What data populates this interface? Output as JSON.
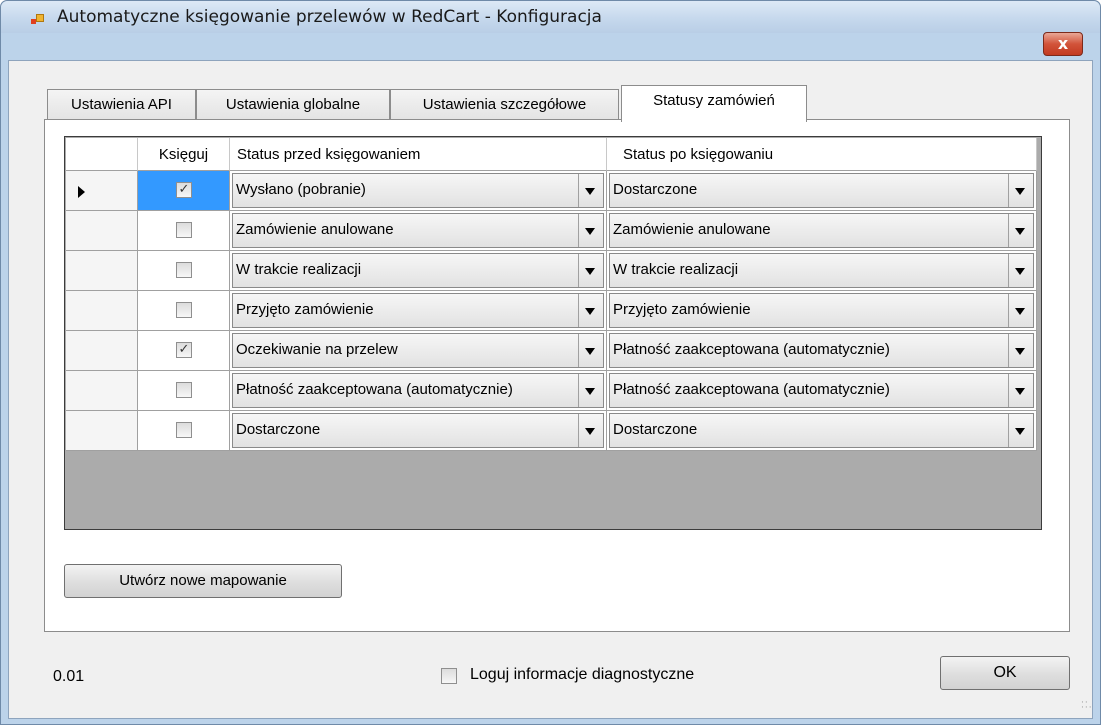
{
  "window": {
    "title": "Automatyczne księgowanie przelewów w RedCart - Konfiguracja",
    "close_label": "x"
  },
  "tabs": [
    {
      "label": "Ustawienia API",
      "active": false
    },
    {
      "label": "Ustawienia globalne",
      "active": false
    },
    {
      "label": "Ustawienia szczegółowe",
      "active": false
    },
    {
      "label": "Statusy zamówień",
      "active": true
    }
  ],
  "grid": {
    "columns": [
      "Księguj",
      "Status przed księgowaniem",
      "Status po księgowaniu"
    ],
    "rows": [
      {
        "post": true,
        "before": "Wysłano (pobranie)",
        "after": "Dostarczone",
        "selected": true
      },
      {
        "post": false,
        "before": "Zamówienie anulowane",
        "after": "Zamówienie anulowane",
        "selected": false
      },
      {
        "post": false,
        "before": "W trakcie realizacji",
        "after": "W trakcie realizacji",
        "selected": false
      },
      {
        "post": false,
        "before": "Przyjęto zamówienie",
        "after": "Przyjęto zamówienie",
        "selected": false
      },
      {
        "post": true,
        "before": "Oczekiwanie na przelew",
        "after": "Płatność zaakceptowana (automatycznie)",
        "selected": false
      },
      {
        "post": false,
        "before": "Płatność zaakceptowana (automatycznie)",
        "after": "Płatność zaakceptowana (automatycznie)",
        "selected": false
      },
      {
        "post": false,
        "before": "Dostarczone",
        "after": "Dostarczone",
        "selected": false
      }
    ]
  },
  "buttons": {
    "new_mapping": "Utwórz nowe mapowanie",
    "ok": "OK"
  },
  "footer": {
    "version": "0.01",
    "diagnostics_label": "Loguj informacje diagnostyczne",
    "diagnostics_checked": false
  }
}
